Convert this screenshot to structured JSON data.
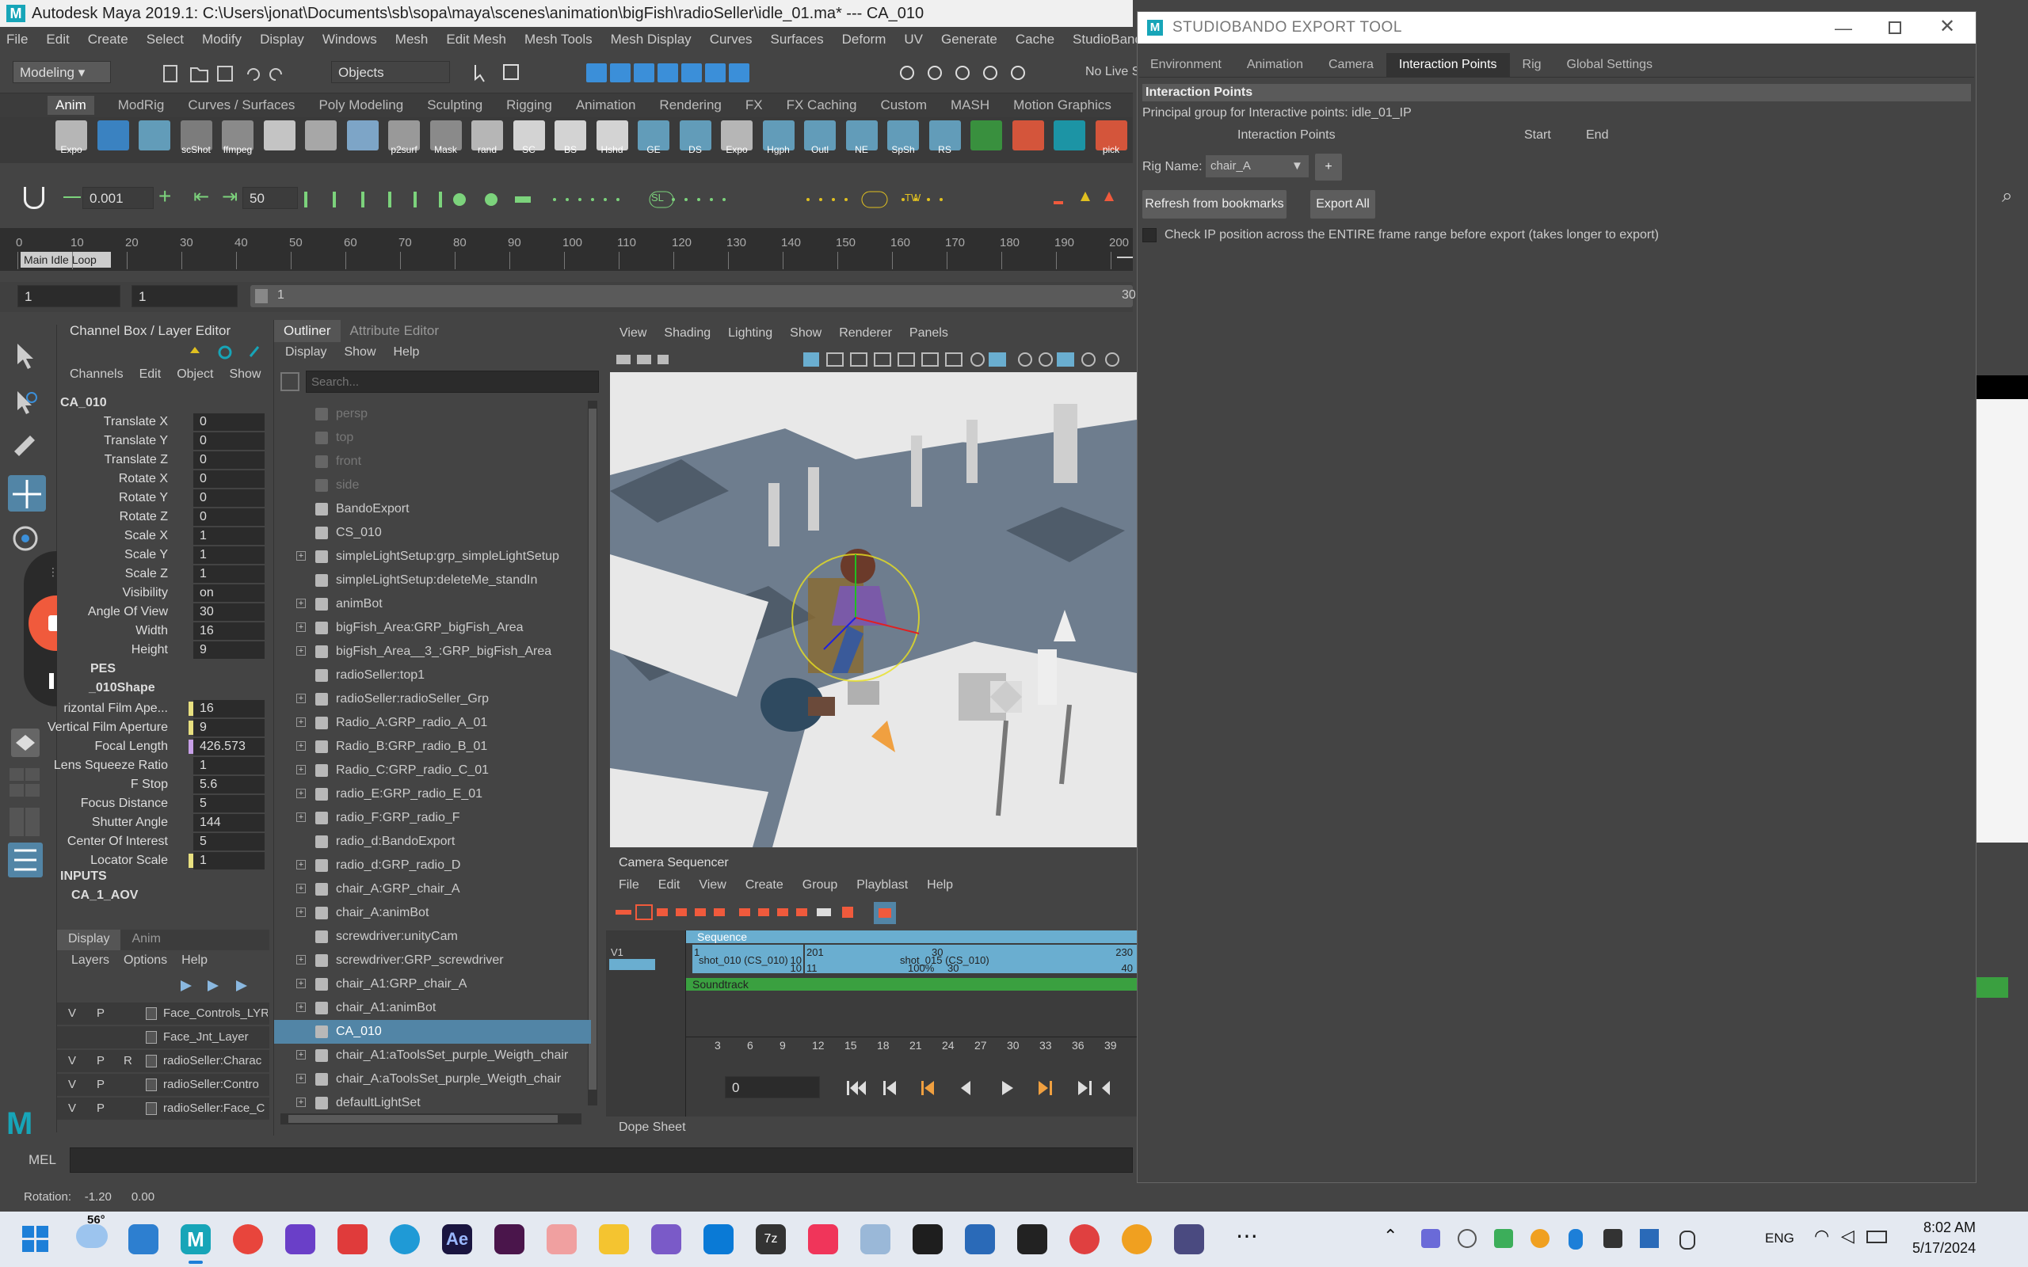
{
  "maya": {
    "window_title": "Autodesk Maya 2019.1: C:\\Users\\jonat\\Documents\\sb\\sopa\\maya\\scenes\\animation\\bigFish\\radioSeller\\idle_01.ma*   ---   CA_010",
    "menu": [
      "File",
      "Edit",
      "Create",
      "Select",
      "Modify",
      "Display",
      "Windows",
      "Mesh",
      "Edit Mesh",
      "Mesh Tools",
      "Mesh Display",
      "Curves",
      "Surfaces",
      "Deform",
      "UV",
      "Generate",
      "Cache",
      "StudioBando"
    ],
    "menuset": "Modeling",
    "select_mode": "Objects",
    "live_surface": "No Live S",
    "shelf_tabs": [
      "Anim",
      "ModRig",
      "Curves / Surfaces",
      "Poly Modeling",
      "Sculpting",
      "Rigging",
      "Animation",
      "Rendering",
      "FX",
      "FX Caching",
      "Custom",
      "MASH",
      "Motion Graphics"
    ],
    "shelf_labels": [
      "Expo",
      "",
      "",
      "scShot",
      "ffmpeg",
      "",
      "",
      "",
      "p2surf",
      "Mask",
      "rand",
      "SC",
      "BS",
      "Hshd",
      "GE",
      "DS",
      "Expo",
      "Hgph",
      "Outl",
      "NE",
      "SpSh",
      "RS",
      "",
      "",
      "",
      "pick"
    ],
    "toolrow": {
      "step": "0.001",
      "value": "50",
      "sl": "SL",
      "tw": "TW"
    },
    "timeline": {
      "ticks": [
        "0",
        "10",
        "20",
        "30",
        "40",
        "50",
        "60",
        "70",
        "80",
        "90",
        "100",
        "110",
        "120",
        "130",
        "140",
        "150",
        "160",
        "170",
        "180",
        "190",
        "200"
      ],
      "bookmark": "Main Idle Loop"
    },
    "range": {
      "start": "1",
      "playstart": "1",
      "current": "1",
      "end": "30"
    },
    "channel_box": {
      "header": "Channel Box / Layer Editor",
      "menu": [
        "Channels",
        "Edit",
        "Object",
        "Show"
      ],
      "object": "CA_010",
      "channels": [
        {
          "name": "Translate X",
          "value": "0"
        },
        {
          "name": "Translate Y",
          "value": "0"
        },
        {
          "name": "Translate Z",
          "value": "0"
        },
        {
          "name": "Rotate X",
          "value": "0"
        },
        {
          "name": "Rotate Y",
          "value": "0"
        },
        {
          "name": "Rotate Z",
          "value": "0"
        },
        {
          "name": "Scale X",
          "value": "1"
        },
        {
          "name": "Scale Y",
          "value": "1"
        },
        {
          "name": "Scale Z",
          "value": "1"
        },
        {
          "name": "Visibility",
          "value": "on"
        },
        {
          "name": "Angle Of View",
          "value": "30"
        },
        {
          "name": "Width",
          "value": "16"
        },
        {
          "name": "Height",
          "value": "9"
        }
      ],
      "shapes_label": "PES",
      "shape_name": "_010Shape",
      "shape_channels": [
        {
          "name": "rizontal Film Ape...",
          "value": "16"
        },
        {
          "name": "Vertical Film Aperture",
          "value": "9"
        },
        {
          "name": "Focal Length",
          "value": "426.573"
        },
        {
          "name": "Lens Squeeze Ratio",
          "value": "1"
        },
        {
          "name": "F Stop",
          "value": "5.6"
        },
        {
          "name": "Focus Distance",
          "value": "5"
        },
        {
          "name": "Shutter Angle",
          "value": "144"
        },
        {
          "name": "Center Of Interest",
          "value": "5"
        },
        {
          "name": "Locator Scale",
          "value": "1"
        }
      ],
      "inputs_label": "INPUTS",
      "input_name": "CA_1_AOV",
      "layer_tabs": [
        "Display",
        "Anim"
      ],
      "layer_menu": [
        "Layers",
        "Options",
        "Help"
      ],
      "layers": [
        {
          "v": "V",
          "p": "P",
          "r": "",
          "name": "Face_Controls_LYR"
        },
        {
          "v": "",
          "p": "",
          "r": "",
          "name": "Face_Jnt_Layer"
        },
        {
          "v": "V",
          "p": "P",
          "r": "R",
          "name": "radioSeller:Charac"
        },
        {
          "v": "V",
          "p": "P",
          "r": "",
          "name": "radioSeller:Contro"
        },
        {
          "v": "V",
          "p": "P",
          "r": "",
          "name": "radioSeller:Face_C"
        }
      ]
    },
    "outliner": {
      "tabs": [
        "Outliner",
        "Attribute Editor"
      ],
      "menu": [
        "Display",
        "Show",
        "Help"
      ],
      "search_placeholder": "Search...",
      "items": [
        {
          "name": "persp",
          "dim": true,
          "exp": false
        },
        {
          "name": "top",
          "dim": true,
          "exp": false
        },
        {
          "name": "front",
          "dim": true,
          "exp": false
        },
        {
          "name": "side",
          "dim": true,
          "exp": false
        },
        {
          "name": "BandoExport",
          "dim": false,
          "exp": false
        },
        {
          "name": "CS_010",
          "dim": false,
          "exp": false
        },
        {
          "name": "simpleLightSetup:grp_simpleLightSetup",
          "dim": false,
          "exp": true
        },
        {
          "name": "simpleLightSetup:deleteMe_standIn",
          "dim": false,
          "exp": false
        },
        {
          "name": "animBot",
          "dim": false,
          "exp": true
        },
        {
          "name": "bigFish_Area:GRP_bigFish_Area",
          "dim": false,
          "exp": true
        },
        {
          "name": "bigFish_Area__3_:GRP_bigFish_Area",
          "dim": false,
          "exp": true
        },
        {
          "name": "radioSeller:top1",
          "dim": false,
          "exp": false
        },
        {
          "name": "radioSeller:radioSeller_Grp",
          "dim": false,
          "exp": true
        },
        {
          "name": "Radio_A:GRP_radio_A_01",
          "dim": false,
          "exp": true
        },
        {
          "name": "Radio_B:GRP_radio_B_01",
          "dim": false,
          "exp": true
        },
        {
          "name": "Radio_C:GRP_radio_C_01",
          "dim": false,
          "exp": true
        },
        {
          "name": "radio_E:GRP_radio_E_01",
          "dim": false,
          "exp": true
        },
        {
          "name": "radio_F:GRP_radio_F",
          "dim": false,
          "exp": true
        },
        {
          "name": "radio_d:BandoExport",
          "dim": false,
          "exp": false
        },
        {
          "name": "radio_d:GRP_radio_D",
          "dim": false,
          "exp": true
        },
        {
          "name": "chair_A:GRP_chair_A",
          "dim": false,
          "exp": true
        },
        {
          "name": "chair_A:animBot",
          "dim": false,
          "exp": true
        },
        {
          "name": "screwdriver:unityCam",
          "dim": false,
          "exp": false
        },
        {
          "name": "screwdriver:GRP_screwdriver",
          "dim": false,
          "exp": true
        },
        {
          "name": "chair_A1:GRP_chair_A",
          "dim": false,
          "exp": true
        },
        {
          "name": "chair_A1:animBot",
          "dim": false,
          "exp": true
        },
        {
          "name": "CA_010",
          "dim": false,
          "exp": false,
          "sel": true
        },
        {
          "name": "chair_A1:aToolsSet_purple_Weigth_chair",
          "dim": false,
          "exp": true
        },
        {
          "name": "chair_A:aToolsSet_purple_Weigth_chair",
          "dim": false,
          "exp": true
        },
        {
          "name": "defaultLightSet",
          "dim": false,
          "exp": true
        }
      ]
    },
    "viewport_menu": [
      "View",
      "Shading",
      "Lighting",
      "Show",
      "Renderer",
      "Panels"
    ],
    "camera_sequencer": {
      "title": "Camera Sequencer",
      "menu": [
        "File",
        "Edit",
        "View",
        "Create",
        "Group",
        "Playblast",
        "Help"
      ],
      "sequence_label": "Sequence",
      "track": "V1",
      "shot1": {
        "name": "shot_010 (CS_010)",
        "start": "1",
        "end": "10",
        "start2": "10",
        "len": "10"
      },
      "shot2": {
        "name": "shot_015 (CS_010)",
        "start": "201",
        "start2": "11",
        "mid": "30",
        "pct": "100%",
        "mid2": "30",
        "end": "230",
        "end2": "40"
      },
      "soundtrack": "Soundtrack",
      "ticks": [
        "3",
        "6",
        "9",
        "12",
        "15",
        "18",
        "21",
        "24",
        "27",
        "30",
        "33",
        "36",
        "39"
      ],
      "frame": "0",
      "dope_sheet": "Dope Sheet"
    },
    "mel_label": "MEL",
    "help_line": "Rotation:    -1.20      0.00"
  },
  "export_tool": {
    "title": "STUDIOBANDO EXPORT TOOL",
    "tabs": [
      "Environment",
      "Animation",
      "Camera",
      "Interaction Points",
      "Rig",
      "Global Settings"
    ],
    "active_tab": "Interaction Points",
    "section_title": "Interaction Points",
    "principal_group": "Principal group for Interactive points: idle_01_IP",
    "col_ip": "Interaction Points",
    "col_start": "Start",
    "col_end": "End",
    "rig_label": "Rig Name:",
    "rig_value": "chair_A",
    "plus": "+",
    "refresh_btn": "Refresh from bookmarks",
    "export_btn": "Export All",
    "check_label": "Check IP position across the ENTIRE frame range before export (takes longer to export)"
  },
  "taskbar": {
    "weather": "56°",
    "lang": "ENG",
    "time": "8:02 AM",
    "date": "5/17/2024"
  },
  "colors": {
    "maya_bg": "#444444",
    "selection": "#5285a6",
    "accent_teal": "#17a5b8",
    "record": "#f05a3c",
    "sequence": "#6aaed0",
    "soundtrack": "#3aa040"
  }
}
